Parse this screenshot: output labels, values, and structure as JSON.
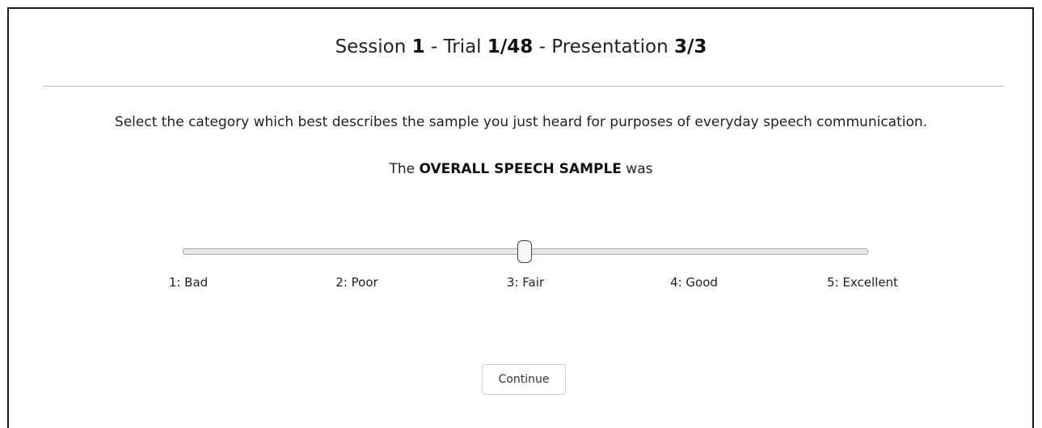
{
  "header": {
    "session_label": "Session ",
    "session_value": "1",
    "trial_label": " - Trial ",
    "trial_value": "1/48",
    "presentation_label": " - Presentation ",
    "presentation_value": "3/3"
  },
  "instruction": "Select the category which best describes the sample you just heard for purposes of everyday speech communication.",
  "prompt": {
    "prefix": "The ",
    "emphasis": "OVERALL SPEECH SAMPLE",
    "suffix": " was"
  },
  "rating_slider": {
    "min": 1,
    "max": 5,
    "value": 3,
    "labels": [
      "1: Bad",
      "2: Poor",
      "3: Fair",
      "4: Good",
      "5: Excellent"
    ]
  },
  "continue_label": "Continue"
}
